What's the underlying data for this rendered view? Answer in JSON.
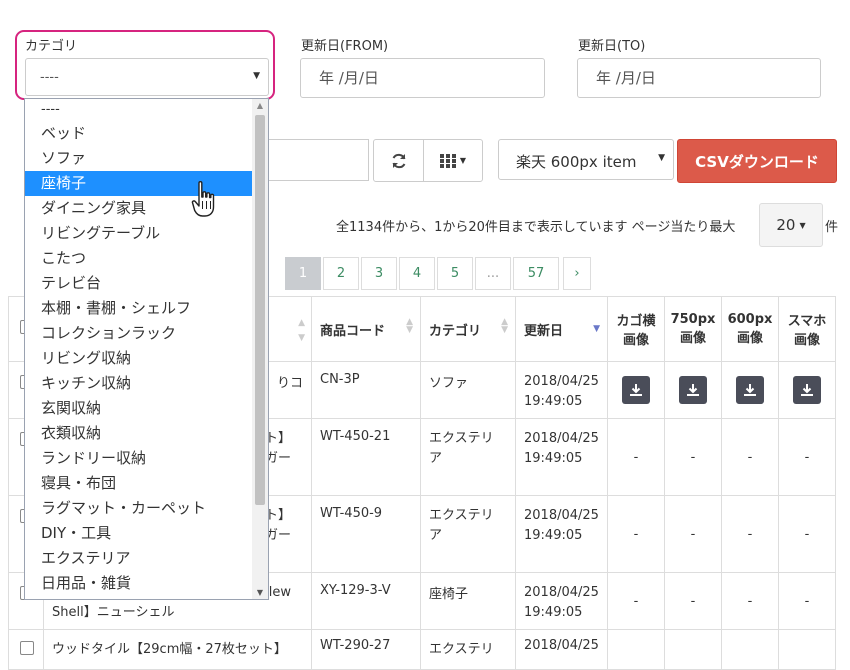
{
  "filters": {
    "category": {
      "label": "カテゴリ",
      "value": "----"
    },
    "date_from": {
      "label": "更新日(FROM)",
      "value": "年 /月/日"
    },
    "date_to": {
      "label": "更新日(TO)",
      "value": "年 /月/日"
    }
  },
  "toolbar": {
    "image_select_value": "楽天 600px item",
    "csv_button": "CSVダウンロード"
  },
  "summary": {
    "text": "全1134件から、1から20件目まで表示しています ページ当たり最大",
    "per_page": "20",
    "suffix": "件"
  },
  "pagination": [
    "1",
    "2",
    "3",
    "4",
    "5",
    "...",
    "57",
    "›"
  ],
  "table": {
    "headers": {
      "code": "商品コード",
      "category": "カテゴリ",
      "updated": "更新日",
      "cart_image": [
        "カゴ横",
        "画像"
      ],
      "px750": [
        "750px",
        "画像"
      ],
      "px600": [
        "600px",
        "画像"
      ],
      "smartphone": [
        "スマホ",
        "画像"
      ]
    },
    "rows": [
      {
        "name": [
          "りコ",
          ""
        ],
        "code": "CN-3P",
        "category": [
          "ソファ",
          ""
        ],
        "date": "2018/04/25",
        "time": "19:49:05",
        "downloads": true
      },
      {
        "name": [
          "ト】",
          "ガー"
        ],
        "code": "WT-450-21",
        "category": [
          "エクステリ",
          "ア"
        ],
        "date": "2018/04/25",
        "time": "19:49:05",
        "downloads": false
      },
      {
        "name": [
          "ト】",
          "ガー"
        ],
        "code": "WT-450-9",
        "category": [
          "エクステリ",
          "ア"
        ],
        "date": "2018/04/25",
        "time": "19:49:05",
        "downloads": false
      },
      {
        "name": [
          "lew",
          "Shell】ニューシェル"
        ],
        "code": "XY-129-3-V",
        "category": [
          "座椅子",
          ""
        ],
        "date": "2018/04/25",
        "time": "19:49:05",
        "downloads": false
      },
      {
        "name": [
          "ウッドタイル【29cm幅・27枚セット】",
          ""
        ],
        "code": "WT-290-27",
        "category": [
          "エクステリ",
          ""
        ],
        "date": "2018/04/25",
        "time": "",
        "downloads": false
      }
    ],
    "dash": "-"
  },
  "dropdown": {
    "options": [
      "----",
      "ベッド",
      "ソファ",
      "座椅子",
      "ダイニング家具",
      "リビングテーブル",
      "こたつ",
      "テレビ台",
      "本棚・書棚・シェルフ",
      "コレクションラック",
      "リビング収納",
      "キッチン収納",
      "玄関収納",
      "衣類収納",
      "ランドリー収納",
      "寝具・布団",
      "ラグマット・カーペット",
      "DIY・工具",
      "エクステリア",
      "日用品・雑貨"
    ],
    "selected_index": 3
  },
  "colors": {
    "highlight": "#d6247f",
    "selected": "#1e90ff",
    "danger": "#dc5a4a"
  }
}
